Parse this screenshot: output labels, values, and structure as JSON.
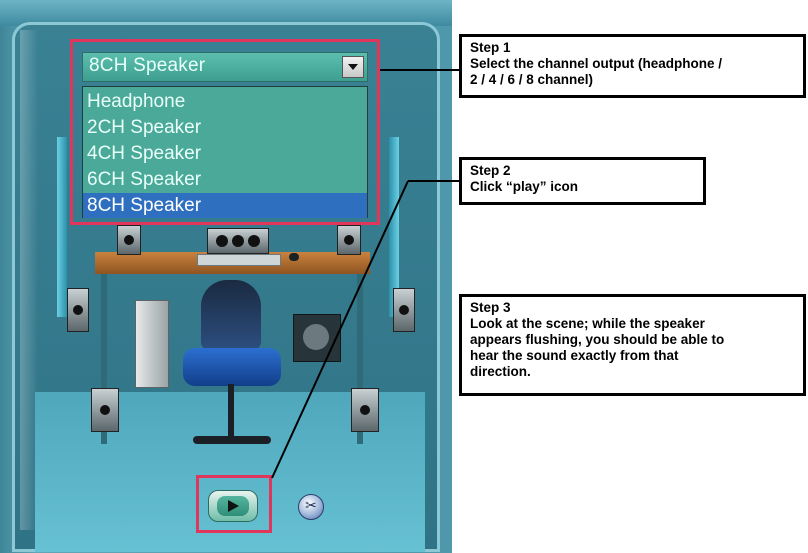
{
  "channel_select": {
    "current_value": "8CH Speaker",
    "options": [
      "Headphone",
      "2CH Speaker",
      "4CH Speaker",
      "6CH Speaker",
      "8CH Speaker"
    ],
    "selected_index": 4
  },
  "controls": {
    "play_icon": "play-icon",
    "tool_icon": "tool-icon"
  },
  "callouts": {
    "step1": {
      "title": "Step 1",
      "lines": [
        "Select the channel output (headphone /",
        "2 / 4 / 6 / 8 channel)"
      ]
    },
    "step2": {
      "title": "Step 2",
      "lines": [
        "Click “play” icon"
      ]
    },
    "step3": {
      "title": "Step 3",
      "lines": [
        "Look at the scene; while the speaker",
        "appears flushing, you should be able to",
        "hear the sound exactly from that",
        "direction."
      ]
    }
  },
  "colors": {
    "highlight": "#e0365c",
    "selected_option": "#2f6fc0",
    "panel": "#4f98ab"
  }
}
